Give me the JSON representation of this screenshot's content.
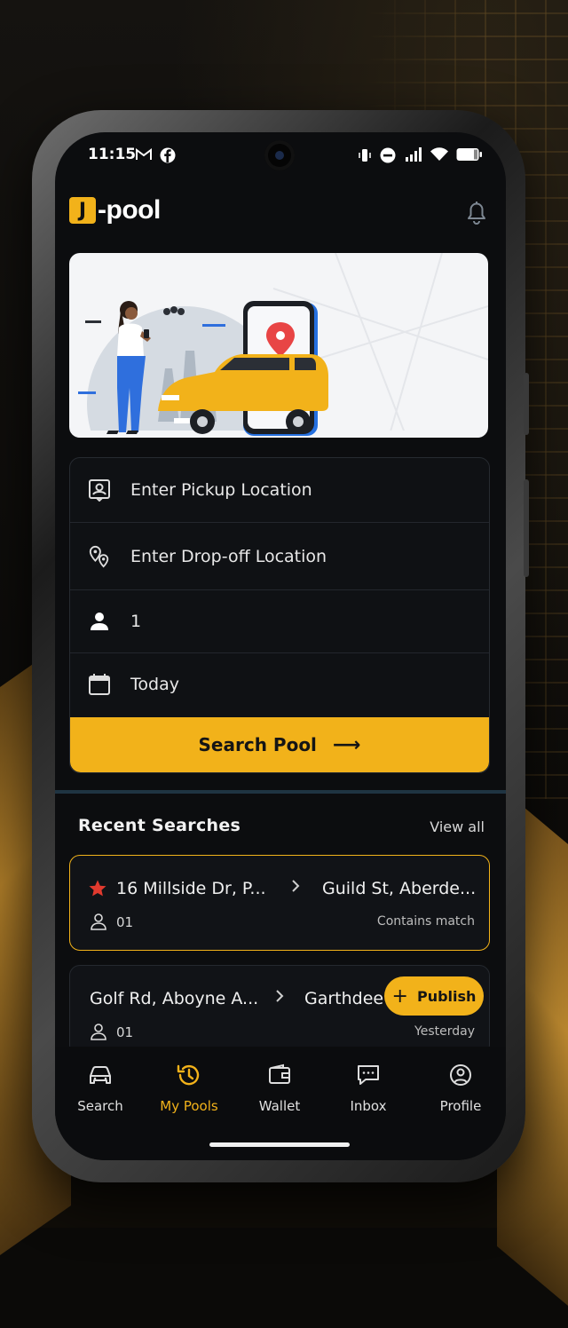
{
  "status_bar": {
    "time": "11:15"
  },
  "app": {
    "logo_mark": "J",
    "logo_text": "-pool"
  },
  "form": {
    "pickup": "Enter Pickup Location",
    "dropoff": "Enter Drop-off Location",
    "passengers": "1",
    "date": "Today",
    "search_label": "Search Pool",
    "search_arrow": "⟶"
  },
  "recent": {
    "title": "Recent Searches",
    "view_all": "View all",
    "items": [
      {
        "from": "16 Millside Dr, P...",
        "to": "Guild St, Aberde...",
        "pax": "01",
        "meta": "Contains match",
        "starred": true
      },
      {
        "from": "Golf Rd, Aboyne A...",
        "to": "Garthdee",
        "pax": "01",
        "meta": "Yesterday",
        "action": "Publish"
      }
    ]
  },
  "nav": {
    "items": [
      {
        "label": "Search",
        "icon": "car-icon"
      },
      {
        "label": "My Pools",
        "icon": "history-icon",
        "active": true
      },
      {
        "label": "Wallet",
        "icon": "wallet-icon"
      },
      {
        "label": "Inbox",
        "icon": "chat-icon"
      },
      {
        "label": "Profile",
        "icon": "profile-icon"
      }
    ]
  },
  "colors": {
    "accent": "#f2b21a",
    "background": "#0c0d0f",
    "card": "#111317"
  }
}
